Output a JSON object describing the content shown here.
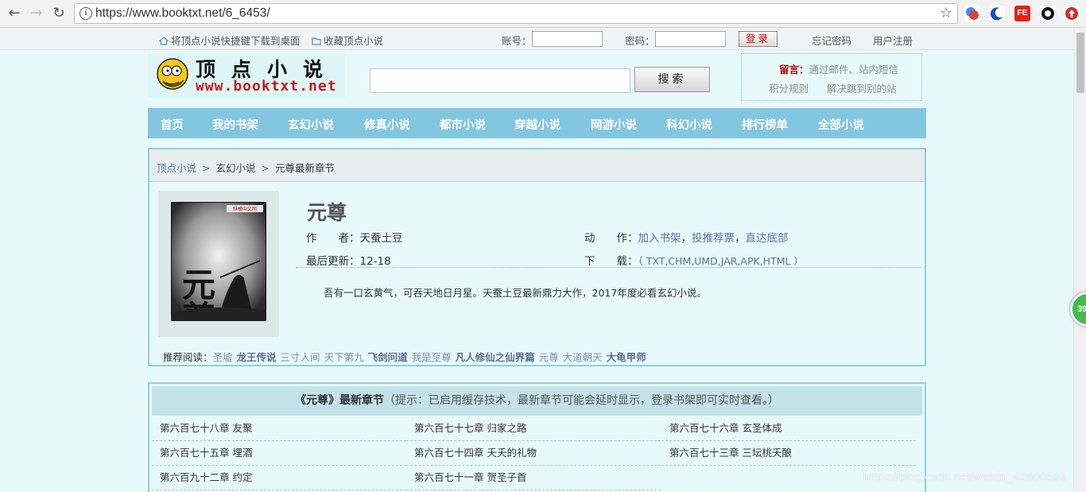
{
  "browser": {
    "url": "https://www.booktxt.net/6_6453/",
    "ext_badge_label": "FE"
  },
  "topbar": {
    "shortcut_link": "将顶点小说快捷键下载到桌面",
    "favorite_link": "收藏顶点小说",
    "account_label": "账号：",
    "password_label": "密码：",
    "login_button": "登录",
    "forgot_password": "忘记密码",
    "register": "用户注册"
  },
  "header": {
    "logo_cn": "顶点小说",
    "logo_en": "www.booktxt.net",
    "search_button": "搜索",
    "notice_label": "留言：",
    "notice_text": "通过邮件、站内短信",
    "notice_links": [
      "积分规则",
      "解决跳到别的站"
    ]
  },
  "nav": {
    "items": [
      "首页",
      "我的书架",
      "玄幻小说",
      "修真小说",
      "都市小说",
      "穿越小说",
      "网游小说",
      "科幻小说",
      "排行榜单",
      "全部小说"
    ]
  },
  "breadcrumb": {
    "home": "顶点小说",
    "category": "玄幻小说",
    "current": "元尊最新章节",
    "sep": ">"
  },
  "book": {
    "title": "元尊",
    "author_label": "作　　者：",
    "author": "天蚕土豆",
    "action_label": "动　　作：",
    "actions": [
      "加入书架",
      "投推荐票",
      "直达底部"
    ],
    "updated_label": "最后更新：",
    "updated": "12-18",
    "download_label": "下　　载：",
    "download": "（ TXT,CHM,UMD,JAR,APK,HTML ）",
    "intro": "吾有一口玄黄气，可吞天地日月星。天蚕土豆最新鼎力大作，2017年度必看玄幻小说。",
    "cover_text": "元尊",
    "cover_publisher": "纵横中文网"
  },
  "recommend": {
    "label": "推荐阅读：",
    "items": [
      "圣墟",
      "龙王传说",
      "三寸人间",
      "天下第九",
      "飞剑问道",
      "我是至尊",
      "凡人修仙之仙界篇",
      "元尊",
      "大道朝天",
      "大龟甲师"
    ]
  },
  "chapters": {
    "header_title": "《元尊》最新章节",
    "header_note": "（提示：已启用缓存技术，最新章节可能会延时显示，登录书架即可实时查看。）",
    "items": [
      "第六百七十八章 友聚",
      "第六百七十七章 归家之路",
      "第六百七十六章 玄圣体成",
      "第六百七十五章 埋酒",
      "第六百七十四章 夭夭的礼物",
      "第六百七十三章 三坛桃夭酿",
      "第六百九十二章 约定",
      "第六百七十一章 贺圣子首"
    ]
  },
  "overlay": {
    "badge": "39",
    "watermark": "https://blog.csdn.net/weixin_42600599"
  }
}
